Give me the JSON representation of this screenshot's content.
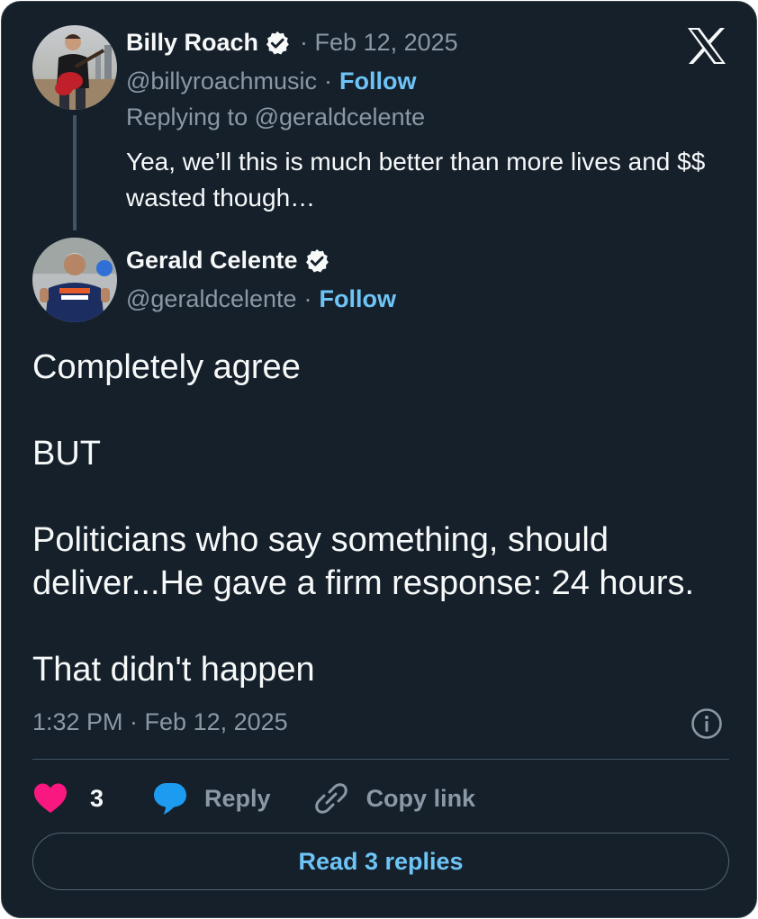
{
  "reply_tweet": {
    "author_name": "Billy Roach",
    "date": "· Feb 12, 2025",
    "handle": "@billyroachmusic",
    "follow_label": "Follow",
    "replying_to": "Replying to @geraldcelente",
    "text": "Yea, we’ll this is much better than more lives and $$ wasted though…"
  },
  "main_tweet": {
    "author_name": "Gerald Celente",
    "handle": "@geraldcelente",
    "follow_label": "Follow",
    "text": "Completely agree\n\nBUT\n\nPoliticians who say something, should deliver...He gave a firm response: 24 hours.\n\nThat didn't happen",
    "timestamp": "1:32 PM · Feb 12, 2025"
  },
  "actions": {
    "like_count": "3",
    "reply_label": "Reply",
    "copy_link_label": "Copy link"
  },
  "read_replies_label": "Read 3 replies",
  "icons": {
    "logo": "x-logo-icon",
    "verified": "verified-badge-icon",
    "like": "heart-icon",
    "reply": "speech-bubble-icon",
    "copy": "link-icon",
    "info": "info-icon"
  },
  "colors": {
    "background": "#15202b",
    "accent": "#6ec4f6",
    "like": "#f91880",
    "reply_icon": "#1d9bf0",
    "muted_text": "#8b98a5"
  }
}
